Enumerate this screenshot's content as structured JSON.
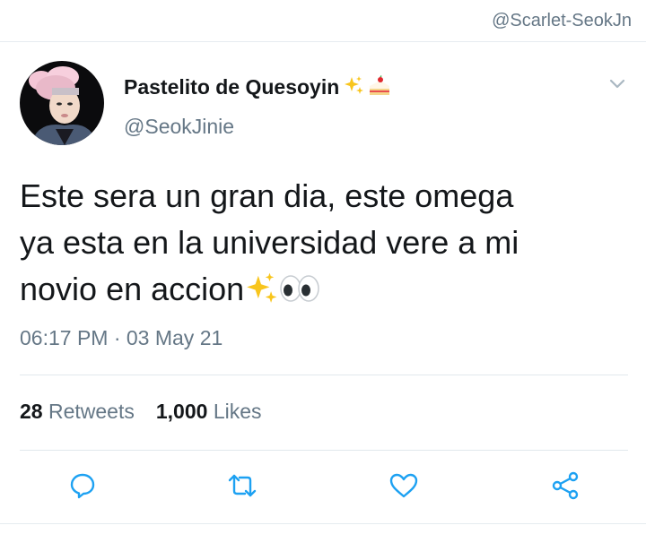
{
  "watermark": "@Scarlet-SeokJn",
  "tweet": {
    "display_name": "Pastelito de Quesoyin",
    "name_emojis": [
      "sparkles-emoji",
      "cake-emoji"
    ],
    "username": "@SeokJinie",
    "text_lines": [
      "Este sera un gran dia, este omega",
      "ya esta en la universidad vere a mi",
      "novio en accion"
    ],
    "text_emojis": [
      "sparkles-emoji",
      "eyes-emoji"
    ],
    "timestamp": "06:17 PM · 03 May 21",
    "stats": {
      "retweets_count": "28",
      "retweets_label": "Retweets",
      "likes_count": "1,000",
      "likes_label": "Likes"
    }
  },
  "actions": [
    "reply-icon",
    "retweet-icon",
    "like-icon",
    "share-icon"
  ],
  "colors": {
    "text": "#14171a",
    "secondary": "#657786",
    "divider": "#e1e8ed",
    "icon": "#1da1f2"
  }
}
